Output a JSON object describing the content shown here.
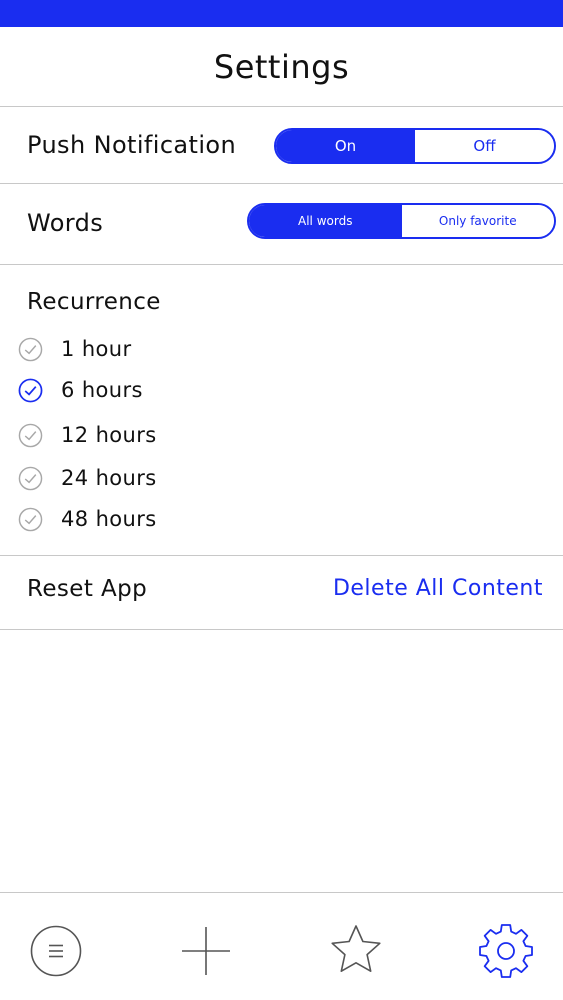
{
  "header": {
    "title": "Settings"
  },
  "push_notification": {
    "label": "Push Notification",
    "on_label": "On",
    "off_label": "Off",
    "selected": "On"
  },
  "words": {
    "label": "Words",
    "all_label": "All words",
    "favorite_label": "Only favorite",
    "selected": "All words"
  },
  "recurrence": {
    "title": "Recurrence",
    "options": [
      {
        "label": "1 hour",
        "selected": false
      },
      {
        "label": "6 hours",
        "selected": true
      },
      {
        "label": "12 hours",
        "selected": false
      },
      {
        "label": "24 hours",
        "selected": false
      },
      {
        "label": "48 hours",
        "selected": false
      }
    ]
  },
  "reset": {
    "label": "Reset App",
    "action_label": "Delete All Content"
  },
  "tabbar": {
    "items": [
      "list-icon",
      "plus-icon",
      "star-icon",
      "gear-icon"
    ],
    "active": "gear-icon"
  },
  "colors": {
    "accent": "#1a2df0",
    "check_inactive": "#a8a8a8",
    "divider": "#c8c8c8",
    "tab_inactive": "#555555"
  }
}
